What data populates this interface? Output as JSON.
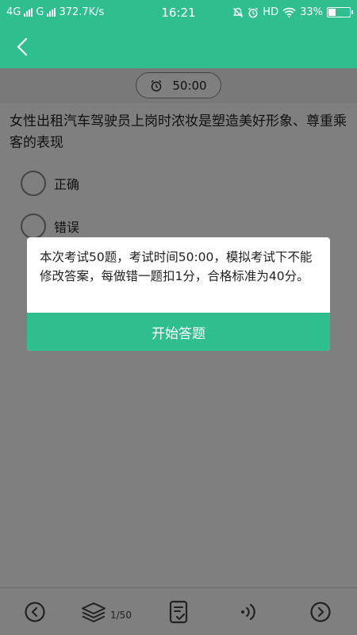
{
  "status_bar": {
    "network_1": "4G",
    "network_2": "G",
    "speed": "372.7K/s",
    "time": "16:21",
    "hd": "HD",
    "battery_percent": "33%",
    "battery_level": 0.33
  },
  "timer": {
    "value": "50:00"
  },
  "question": {
    "text": "女性出租汽车驾驶员上岗时浓妆是塑造美好形象、尊重乘客的表现",
    "options": [
      "正确",
      "错误"
    ]
  },
  "dialog": {
    "message": "本次考试50题，考试时间50:00，模拟考试下不能修改答案，每做错一题扣1分，合格标准为40分。",
    "button_label": "开始答题"
  },
  "bottom_bar": {
    "page_count": "1/50"
  },
  "colors": {
    "accent": "#2fbf8e",
    "mask": "rgba(0,0,0,0.5)"
  }
}
